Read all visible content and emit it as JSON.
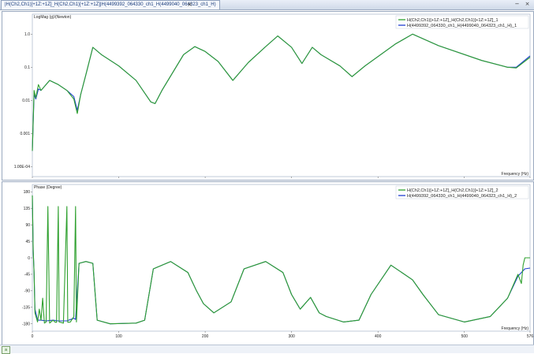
{
  "window": {
    "tab_title": "|H(Ch2,Ch1)[+1Z:+1Z]_H(Ch2,Ch1)[+1Z:+1Z]|H(4499392_064330_ch1_H(4499040_064323_ch1_H)",
    "tab_close": "×",
    "minimize": "−",
    "close": "×"
  },
  "status_icon": "a",
  "colors": {
    "series1": "#2ea02e",
    "series2": "#1f3fd0",
    "frame": "#9aa9bf"
  },
  "chart_data": [
    {
      "type": "line",
      "title": "LogMag (g)/(Newton)",
      "xlabel": "Frequency (Hz)",
      "x_ticks": [
        "0",
        "100",
        "200",
        "300",
        "400",
        "500",
        "576"
      ],
      "xlim": [
        0,
        576
      ],
      "y_scale": "log",
      "y_ticks": [
        "1.0",
        "0.1",
        "0.01",
        "0.001",
        "1.00E-04"
      ],
      "ylim": [
        5e-05,
        4
      ],
      "legend_position": "top-right",
      "series": [
        {
          "name": "H(Ch2,Ch1)[+1Z:+1Z]_H(Ch2,Ch1)[+1Z:+1Z]_1",
          "points": [
            [
              0,
              0.0003
            ],
            [
              2,
              0.02
            ],
            [
              4,
              0.012
            ],
            [
              7,
              0.03
            ],
            [
              10,
              0.02
            ],
            [
              20,
              0.04
            ],
            [
              30,
              0.03
            ],
            [
              40,
              0.02
            ],
            [
              48,
              0.011
            ],
            [
              52,
              0.004
            ],
            [
              56,
              0.015
            ],
            [
              62,
              0.06
            ],
            [
              70,
              0.4
            ],
            [
              80,
              0.24
            ],
            [
              100,
              0.11
            ],
            [
              120,
              0.04
            ],
            [
              137,
              0.009
            ],
            [
              142,
              0.008
            ],
            [
              150,
              0.02
            ],
            [
              175,
              0.24
            ],
            [
              188,
              0.42
            ],
            [
              200,
              0.3
            ],
            [
              215,
              0.15
            ],
            [
              232,
              0.04
            ],
            [
              250,
              0.14
            ],
            [
              270,
              0.42
            ],
            [
              284,
              0.88
            ],
            [
              300,
              0.4
            ],
            [
              312,
              0.13
            ],
            [
              324,
              0.4
            ],
            [
              334,
              0.24
            ],
            [
              356,
              0.11
            ],
            [
              370,
              0.052
            ],
            [
              385,
              0.11
            ],
            [
              420,
              0.5
            ],
            [
              440,
              1.0
            ],
            [
              470,
              0.45
            ],
            [
              520,
              0.16
            ],
            [
              550,
              0.1
            ],
            [
              560,
              0.095
            ],
            [
              576,
              0.2
            ]
          ]
        },
        {
          "name": "H(4499392_064330_ch1_H(4499040_064323_ch1_H)_1",
          "points": [
            [
              0,
              0.0003
            ],
            [
              2,
              0.015
            ],
            [
              4,
              0.011
            ],
            [
              7,
              0.022
            ],
            [
              10,
              0.02
            ],
            [
              20,
              0.04
            ],
            [
              30,
              0.03
            ],
            [
              40,
              0.02
            ],
            [
              48,
              0.013
            ],
            [
              52,
              0.005
            ],
            [
              56,
              0.015
            ],
            [
              62,
              0.06
            ],
            [
              70,
              0.4
            ],
            [
              80,
              0.24
            ],
            [
              100,
              0.11
            ],
            [
              120,
              0.04
            ],
            [
              137,
              0.009
            ],
            [
              142,
              0.008
            ],
            [
              150,
              0.02
            ],
            [
              175,
              0.24
            ],
            [
              188,
              0.42
            ],
            [
              200,
              0.3
            ],
            [
              215,
              0.15
            ],
            [
              232,
              0.04
            ],
            [
              250,
              0.14
            ],
            [
              270,
              0.42
            ],
            [
              284,
              0.88
            ],
            [
              300,
              0.4
            ],
            [
              312,
              0.13
            ],
            [
              324,
              0.4
            ],
            [
              334,
              0.24
            ],
            [
              356,
              0.11
            ],
            [
              370,
              0.052
            ],
            [
              385,
              0.11
            ],
            [
              420,
              0.5
            ],
            [
              440,
              1.0
            ],
            [
              470,
              0.45
            ],
            [
              520,
              0.16
            ],
            [
              550,
              0.1
            ],
            [
              560,
              0.1
            ],
            [
              576,
              0.22
            ]
          ]
        }
      ]
    },
    {
      "type": "line",
      "title": "Phase (Degree)",
      "xlabel": "Frequency (Hz)",
      "x_ticks": [
        "0",
        "100",
        "200",
        "300",
        "400",
        "500",
        "576"
      ],
      "xlim": [
        0,
        576
      ],
      "y_ticks": [
        "180",
        "135",
        "90",
        "45",
        "0",
        "-45",
        "-90",
        "-135",
        "-180"
      ],
      "ylim": [
        -200,
        200
      ],
      "legend_position": "top-right",
      "series": [
        {
          "name": "H(Ch2,Ch1)[+1Z:+1Z]_H(Ch2,Ch1)[+1Z:+1Z]_2",
          "points": [
            [
              0,
              170
            ],
            [
              1,
              20
            ],
            [
              2,
              -40
            ],
            [
              3,
              -150
            ],
            [
              6,
              -175
            ],
            [
              8,
              -140
            ],
            [
              10,
              -170
            ],
            [
              12,
              -110
            ],
            [
              14,
              -178
            ],
            [
              16,
              -175
            ],
            [
              18,
              140
            ],
            [
              20,
              -178
            ],
            [
              24,
              -170
            ],
            [
              26,
              -175
            ],
            [
              28,
              -176
            ],
            [
              30,
              140
            ],
            [
              31,
              -175
            ],
            [
              36,
              -178
            ],
            [
              40,
              140
            ],
            [
              41,
              -176
            ],
            [
              44,
              -175
            ],
            [
              48,
              -160
            ],
            [
              50,
              140
            ],
            [
              51,
              -175
            ],
            [
              54,
              -15
            ],
            [
              62,
              -10
            ],
            [
              70,
              -15
            ],
            [
              75,
              -170
            ],
            [
              90,
              -180
            ],
            [
              120,
              -178
            ],
            [
              130,
              -170
            ],
            [
              140,
              -30
            ],
            [
              160,
              -10
            ],
            [
              180,
              -40
            ],
            [
              190,
              -90
            ],
            [
              198,
              -125
            ],
            [
              210,
              -150
            ],
            [
              230,
              -120
            ],
            [
              245,
              -30
            ],
            [
              270,
              -10
            ],
            [
              290,
              -40
            ],
            [
              300,
              -100
            ],
            [
              310,
              -140
            ],
            [
              322,
              -108
            ],
            [
              332,
              -150
            ],
            [
              340,
              -160
            ],
            [
              360,
              -175
            ],
            [
              378,
              -170
            ],
            [
              392,
              -100
            ],
            [
              415,
              -20
            ],
            [
              440,
              -60
            ],
            [
              452,
              -100
            ],
            [
              470,
              -155
            ],
            [
              500,
              -175
            ],
            [
              530,
              -160
            ],
            [
              550,
              -110
            ],
            [
              562,
              -45
            ],
            [
              566,
              -70
            ],
            [
              568,
              -20
            ],
            [
              570,
              0
            ],
            [
              576,
              0
            ]
          ]
        },
        {
          "name": "H(4499392_064330_ch1_H(4499040_064323_ch1_H)_2",
          "points": [
            [
              0,
              170
            ],
            [
              1,
              20
            ],
            [
              2,
              -40
            ],
            [
              3,
              -140
            ],
            [
              6,
              -170
            ],
            [
              10,
              -170
            ],
            [
              16,
              -172
            ],
            [
              24,
              -170
            ],
            [
              30,
              -172
            ],
            [
              40,
              -172
            ],
            [
              48,
              -165
            ],
            [
              50,
              -168
            ],
            [
              54,
              -15
            ],
            [
              62,
              -10
            ],
            [
              70,
              -15
            ],
            [
              75,
              -170
            ],
            [
              90,
              -180
            ],
            [
              120,
              -178
            ],
            [
              130,
              -170
            ],
            [
              140,
              -30
            ],
            [
              160,
              -10
            ],
            [
              180,
              -40
            ],
            [
              190,
              -90
            ],
            [
              198,
              -125
            ],
            [
              210,
              -150
            ],
            [
              230,
              -120
            ],
            [
              245,
              -30
            ],
            [
              270,
              -10
            ],
            [
              290,
              -40
            ],
            [
              300,
              -100
            ],
            [
              310,
              -140
            ],
            [
              322,
              -108
            ],
            [
              332,
              -150
            ],
            [
              340,
              -160
            ],
            [
              360,
              -175
            ],
            [
              378,
              -170
            ],
            [
              392,
              -100
            ],
            [
              415,
              -20
            ],
            [
              440,
              -60
            ],
            [
              452,
              -100
            ],
            [
              470,
              -155
            ],
            [
              500,
              -175
            ],
            [
              530,
              -160
            ],
            [
              550,
              -110
            ],
            [
              562,
              -50
            ],
            [
              570,
              -30
            ],
            [
              576,
              -28
            ]
          ]
        }
      ]
    }
  ]
}
